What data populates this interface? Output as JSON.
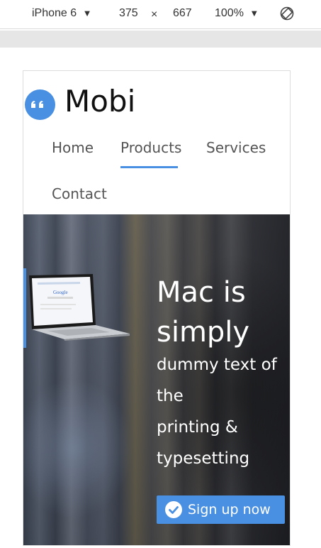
{
  "devtools": {
    "device": "iPhone 6",
    "width": "375",
    "times": "×",
    "height": "667",
    "zoom": "100%",
    "dropdown_glyph": "▼",
    "rotate_icon": "rotate-icon"
  },
  "site": {
    "logo_icon": "quote-icon",
    "logo_text": "Mobi",
    "accent_color": "#4a90e2"
  },
  "nav": {
    "items": [
      {
        "label": "Home",
        "active": false
      },
      {
        "label": "Products",
        "active": true
      },
      {
        "label": "Services",
        "active": false
      },
      {
        "label": "Contact",
        "active": false
      }
    ]
  },
  "hero": {
    "image": "laptop-image",
    "title": "Mac is simply",
    "subtitle_lines": [
      "dummy text of",
      "the",
      "printing &",
      "typesetting"
    ],
    "cta_label": "Sign up now",
    "cta_icon": "check-circle-icon"
  }
}
